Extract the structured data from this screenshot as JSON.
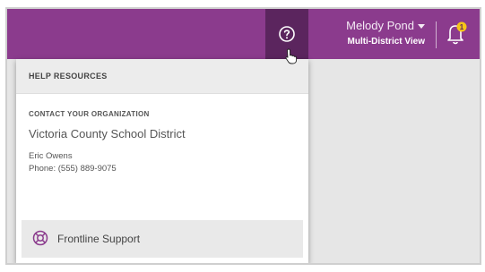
{
  "header": {
    "user_name": "Melody Pond",
    "view_label": "Multi-District View",
    "notification_count": "1"
  },
  "help_menu": {
    "title": "HELP RESOURCES",
    "section_title": "CONTACT YOUR ORGANIZATION",
    "organization_name": "Victoria County School District",
    "contact_name": "Eric Owens",
    "contact_phone": "Phone: (555) 889-9075",
    "support_label": "Frontline Support"
  },
  "colors": {
    "topbar": "#8b3b8d",
    "help_button_active": "#5b255e",
    "notification_badge": "#f5c518"
  },
  "icons": {
    "help": "help-icon",
    "caret": "chevron-down-icon",
    "bell": "bell-icon",
    "support": "lifebuoy-icon",
    "cursor": "pointer-cursor-icon"
  }
}
